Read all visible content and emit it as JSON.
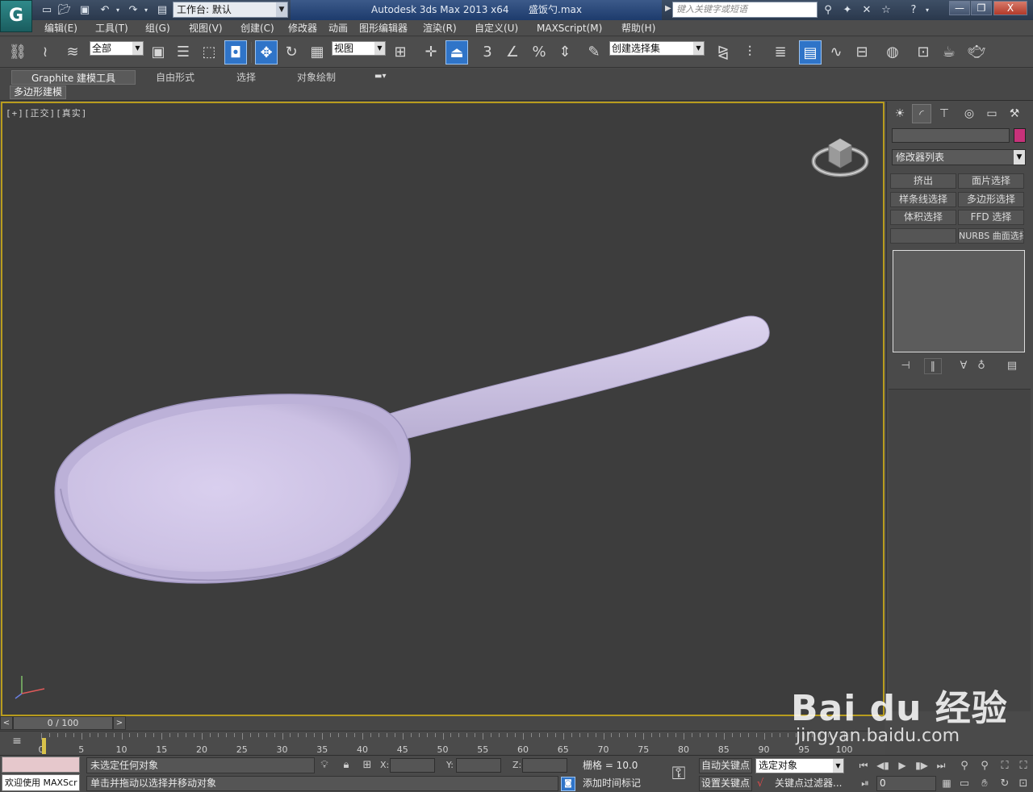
{
  "titlebar": {
    "app_title": "Autodesk 3ds Max  2013 x64",
    "file_name": "盛饭勺.max",
    "workspace_label": "工作台: 默认",
    "search_placeholder": "键入关键字或短语",
    "close_label": "X",
    "min_label": "—",
    "max_label": "❐"
  },
  "menu": [
    "编辑(E)",
    "工具(T)",
    "组(G)",
    "视图(V)",
    "创建(C)",
    "修改器",
    "动画",
    "图形编辑器",
    "渲染(R)",
    "自定义(U)",
    "MAXScript(M)",
    "帮助(H)"
  ],
  "toolbar": {
    "selection_filter": "全部",
    "ref_coord": "视图",
    "named_selection": "创建选择集"
  },
  "ribbon": {
    "tabs": [
      "Graphite 建模工具",
      "自由形式",
      "选择",
      "对象绘制"
    ],
    "sub_label": "多边形建模"
  },
  "viewport": {
    "label": "[+][正交][真实]",
    "object_color": "#cfc4e6",
    "border_color": "#b89c1e"
  },
  "command_panel": {
    "modifier_list": "修改器列表",
    "object_color": "#c8327a",
    "modifier_buttons": [
      "挤出",
      "面片选择",
      "样条线选择",
      "多边形选择",
      "体积选择",
      "FFD 选择",
      "",
      "NURBS 曲面选择"
    ]
  },
  "timeslider": {
    "position": "0 / 100",
    "prev": "<",
    "next": ">"
  },
  "trackbar": {
    "ticks": [
      0,
      5,
      10,
      15,
      20,
      25,
      30,
      35,
      40,
      45,
      50,
      55,
      60,
      65,
      70,
      75,
      80,
      85,
      90,
      95,
      100
    ]
  },
  "status": {
    "welcome": "欢迎使用 MAXScr",
    "selection": "未选定任何对象",
    "prompt": "单击并拖动以选择并移动对象",
    "x_label": "X:",
    "y_label": "Y:",
    "z_label": "Z:",
    "grid": "栅格 = 10.0",
    "add_time_tag": "添加时间标记",
    "auto_key": "自动关键点",
    "set_key": "设置关键点",
    "key_mode": "选定对象",
    "key_filters": "关键点过滤器...",
    "frame": "0"
  },
  "watermark": {
    "logo": "Bai du 经验",
    "url": "jingyan.baidu.com"
  }
}
